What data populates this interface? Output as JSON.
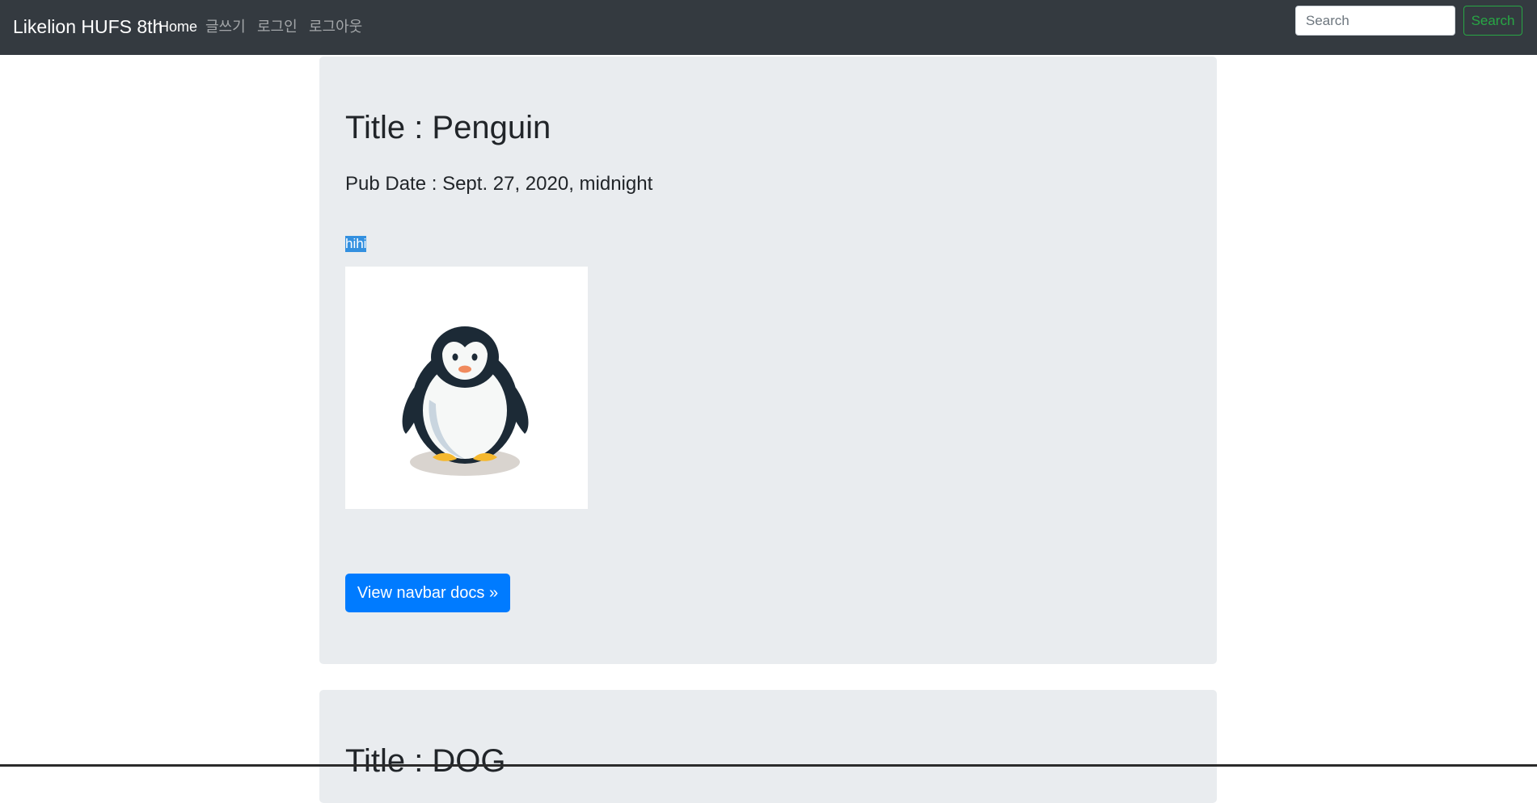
{
  "navbar": {
    "brand": "Likelion HUFS 8th",
    "links": [
      "Home",
      "글쓰기",
      "로그인",
      "로그아웃"
    ],
    "search_placeholder": "Search",
    "search_button": "Search"
  },
  "posts": [
    {
      "title": "Title : Penguin",
      "pub_date": "Pub Date : Sept. 27, 2020, midnight",
      "body": "hihi",
      "image_icon": "penguin-illustration",
      "button_label": "View navbar docs »"
    },
    {
      "title": "Title : DOG"
    }
  ],
  "colors": {
    "navbar_bg": "#343a40",
    "jumbotron_bg": "#e9ecef",
    "primary": "#007bff",
    "success": "#28a745",
    "selection": "#3390e0"
  }
}
